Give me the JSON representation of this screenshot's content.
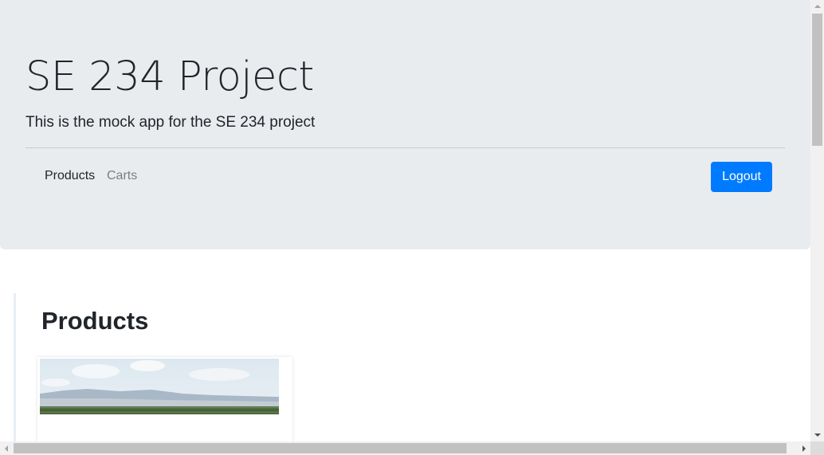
{
  "header": {
    "title": "SE 234 Project",
    "subtitle": "This is the mock app for the SE 234 project"
  },
  "nav": {
    "items": [
      {
        "label": "Products",
        "active": true
      },
      {
        "label": "Carts",
        "active": false
      }
    ],
    "logout_label": "Logout"
  },
  "products": {
    "heading": "Products",
    "cards": [
      {
        "image": "landscape-photo"
      }
    ]
  },
  "colors": {
    "jumbotron_bg": "#e9ecef",
    "primary": "#007bff",
    "muted_link": "#7d7d7d"
  }
}
